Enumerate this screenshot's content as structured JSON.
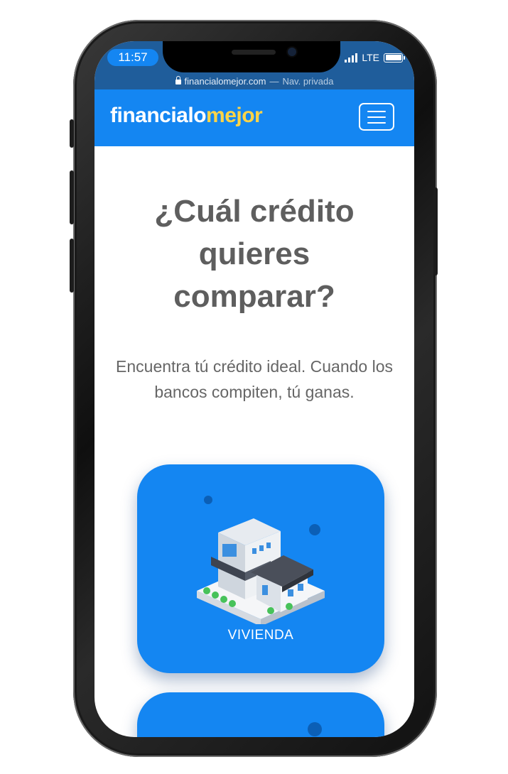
{
  "status_bar": {
    "time": "11:57",
    "network": "LTE"
  },
  "browser": {
    "url": "financialomejor.com",
    "separator": "—",
    "mode": "Nav. privada"
  },
  "navbar": {
    "logo_part1": "financialo",
    "logo_part2": "mejor",
    "brand_color": "#1486f2",
    "accent_color": "#ffd447"
  },
  "hero": {
    "title": "¿Cuál crédito quieres comparar?",
    "subtitle": "Encuentra tú crédito ideal. Cuando los bancos compiten, tú ganas."
  },
  "cards": [
    {
      "label": "VIVIENDA",
      "icon": "house-icon"
    }
  ]
}
